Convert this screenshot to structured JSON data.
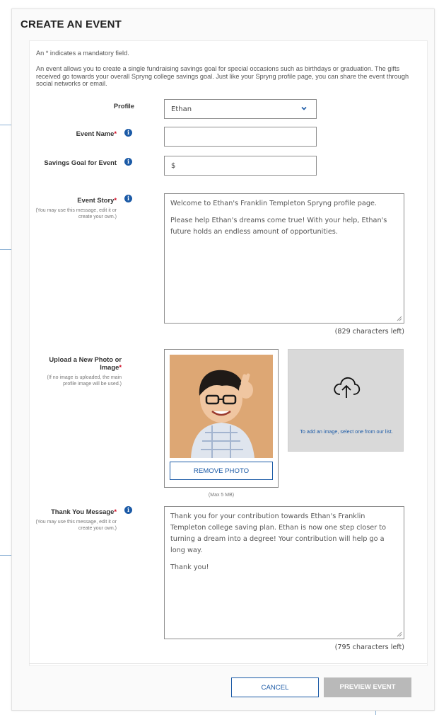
{
  "page": {
    "title": "CREATE AN EVENT",
    "mandatory_note": "An * indicates a mandatory field.",
    "intro": "An event allows you to create a single fundraising savings goal for special occasions such as birthdays or graduation. The gifts received go towards your overall Spryng college savings goal. Just like your Spryng profile page, you can share the event through social networks or email."
  },
  "form": {
    "profile": {
      "label": "Profile",
      "value": "Ethan"
    },
    "event_name": {
      "label": "Event Name",
      "required": "*",
      "value": ""
    },
    "savings_goal": {
      "label": "Savings Goal for Event",
      "value": "$"
    },
    "event_story": {
      "label": "Event Story",
      "required": "*",
      "hint": "(You may use this message, edit it or create your own.)",
      "paragraphs": [
        "Welcome to Ethan's Franklin Templeton Spryng profile page.",
        "Please help Ethan's dreams come true!  With your help, Ethan's future holds an endless amount of opportunities."
      ],
      "counter": "(829 characters left)"
    },
    "photo": {
      "label": "Upload a New Photo or Image",
      "required": "*",
      "hint": "(If no image is uploaded, the main profile image will be used.)",
      "remove_label": "REMOVE PHOTO",
      "max_size": "(Max 5 MB)",
      "upload_prompt": "To add an image, select one from our list."
    },
    "thank_you": {
      "label": "Thank You Message",
      "required": "*",
      "hint": "(You may use this message, edit it or create your own.)",
      "paragraphs": [
        "Thank you for your contribution towards Ethan's Franklin Templeton college saving plan. Ethan is now one step closer to turning a dream into a degree! Your contribution will help go a long way.",
        "Thank you!"
      ],
      "counter": "(795 characters left)"
    }
  },
  "buttons": {
    "cancel": "CANCEL",
    "preview": "PREVIEW EVENT"
  },
  "colors": {
    "accent": "#1b5aa6",
    "required": "#d0021b",
    "callout": "#8fb4d6",
    "preview_bg": "#b9b9b9",
    "upload_bg": "#d9d9d9"
  },
  "icons": {
    "info": "info-icon",
    "dropdown": "chevron-down-icon",
    "upload": "cloud-upload-icon",
    "resize": "resize-grip-icon"
  }
}
